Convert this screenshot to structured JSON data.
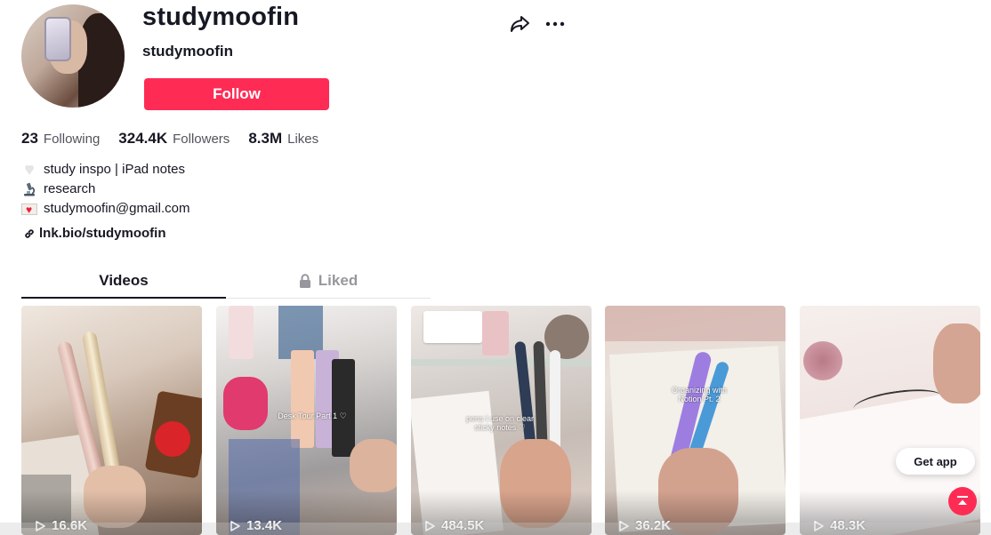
{
  "profile": {
    "username": "studymoofin",
    "nickname": "studymoofin",
    "follow_label": "Follow",
    "accent_color": "#fe2c55"
  },
  "stats": [
    {
      "value": "23",
      "label": "Following"
    },
    {
      "value": "324.4K",
      "label": "Followers"
    },
    {
      "value": "8.3M",
      "label": "Likes"
    }
  ],
  "bio": [
    {
      "icon": "white-heart-icon",
      "text": "study inspo | iPad notes"
    },
    {
      "icon": "microscope-icon",
      "text": "research"
    },
    {
      "icon": "love-letter-icon",
      "text": "studymoofin@gmail.com"
    }
  ],
  "link": {
    "text": "lnk.bio/studymoofin",
    "icon": "link-icon"
  },
  "tabs": [
    {
      "label": "Videos",
      "active": true
    },
    {
      "label": "Liked",
      "active": false,
      "icon": "lock-icon"
    }
  ],
  "videos": [
    {
      "views": "16.6K",
      "caption": ""
    },
    {
      "views": "13.4K",
      "caption": "Desk Tour Part 1 ♡"
    },
    {
      "views": "484.5K",
      "caption": "pens I use on clear sticky notes ♡"
    },
    {
      "views": "36.2K",
      "caption": "Organizing with Notion Pt. 2"
    },
    {
      "views": "48.3K",
      "caption": ""
    }
  ],
  "floating": {
    "get_app_label": "Get app",
    "back_to_top_icon": "back-to-top-icon"
  }
}
